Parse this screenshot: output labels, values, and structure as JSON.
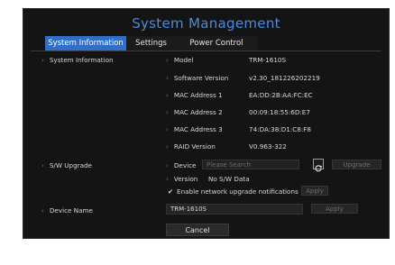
{
  "title": "System Management",
  "tabs": [
    {
      "label": "System Information"
    },
    {
      "label": "Settings"
    },
    {
      "label": "Power Control"
    }
  ],
  "sections": {
    "system_info": {
      "label": "System Information",
      "rows": [
        {
          "label": "Model",
          "value": "TRM-1610S"
        },
        {
          "label": "Software Version",
          "value": "v2.30_181226202219"
        },
        {
          "label": "MAC Address 1",
          "value": "EA:DD:2B:AA:FC:EC"
        },
        {
          "label": "MAC Address 2",
          "value": "00:09:18:55:6D:E7"
        },
        {
          "label": "MAC Address 3",
          "value": "74:DA:38:D1:C8:F8"
        },
        {
          "label": "RAID Version",
          "value": "V0.963-322"
        }
      ]
    },
    "sw_upgrade": {
      "label": "S/W Upgrade",
      "device_label": "Device",
      "device_placeholder": "Please Search",
      "upgrade_button": "Upgrade",
      "version_label": "Version",
      "version_value": "No S/W Data",
      "notify_label": "Enable network upgrade notifications",
      "notify_checked": true,
      "apply_button": "Apply"
    },
    "device_name": {
      "label": "Device Name",
      "value": "TRM-1610S",
      "apply_button": "Apply"
    }
  },
  "cancel_button": "Cancel",
  "colors": {
    "accent": "#2f6fc9",
    "title": "#4a8bdc",
    "background": "#141414"
  }
}
